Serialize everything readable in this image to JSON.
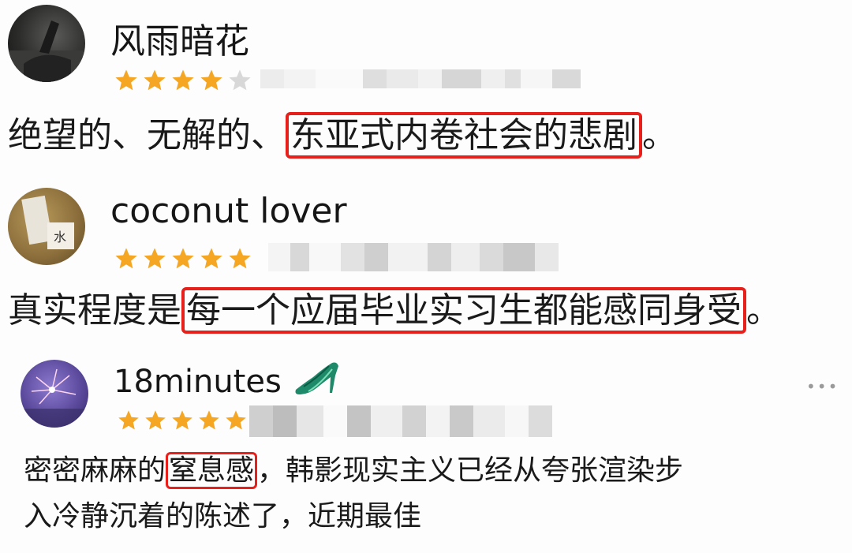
{
  "reviews": [
    {
      "username": "风雨暗花",
      "rating": 4,
      "text_before": "绝望的、无解的、",
      "text_highlight": "东亚式内卷社会的悲剧",
      "text_after": "。"
    },
    {
      "username": "coconut lover",
      "rating": 5,
      "text_before": "真实程度是",
      "text_highlight": "每一个应届毕业实习生都能感同身受",
      "text_after": "。"
    },
    {
      "username": "18minutes",
      "user_badge_icon": "high-heel-shoe-icon",
      "rating": 5,
      "more_label": "•••",
      "text_before": "密密麻麻的",
      "text_highlight": "窒息感",
      "text_after_line1": "，韩影现实主义已经从夸张渲染步",
      "text_line2": "入冷静沉着的陈述了，近期最佳"
    }
  ],
  "colors": {
    "star_filled": "#f5a623",
    "star_empty": "#d8d8d8",
    "highlight_border": "#e8201c",
    "text": "#1a1a1a"
  }
}
